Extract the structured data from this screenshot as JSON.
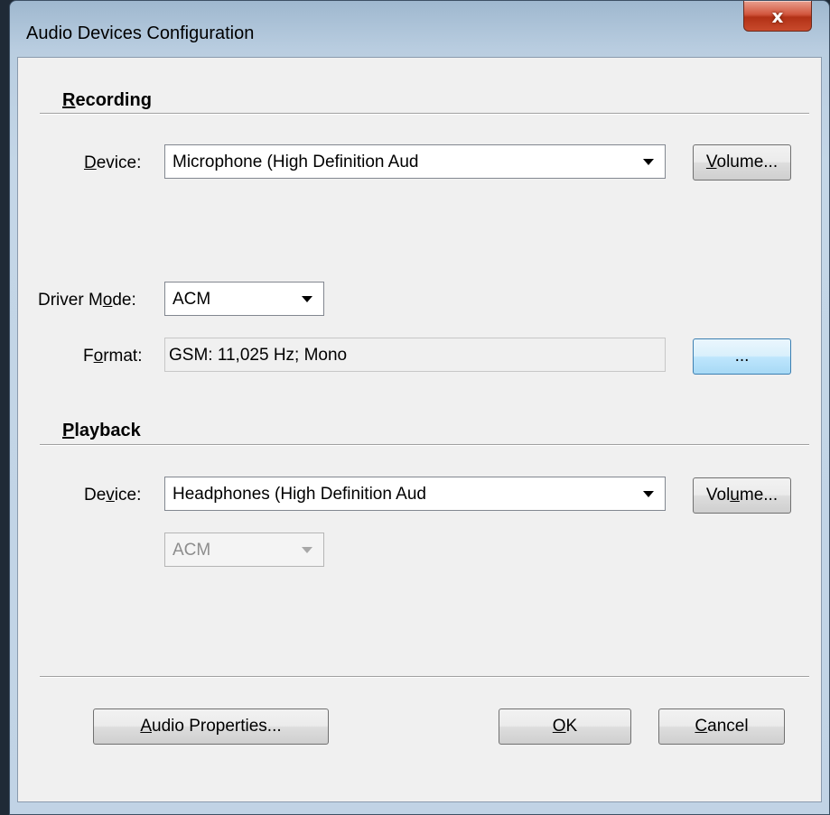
{
  "window": {
    "title": "Audio Devices Configuration",
    "close_glyph": "x"
  },
  "recording": {
    "group_label_first": "R",
    "group_label_rest": "ecording",
    "device_label_pre": "",
    "device_label_key": "D",
    "device_label_post": "evice:",
    "device_value": "Microphone (High Definition Aud",
    "volume_key": "V",
    "volume_rest": "olume...",
    "driver_mode_label_pre": "Driver M",
    "driver_mode_label_key": "o",
    "driver_mode_label_post": "de:",
    "driver_mode_value": "ACM",
    "format_label_pre": "F",
    "format_label_key": "o",
    "format_label_post": "rmat:",
    "format_value": "GSM: 11,025 Hz; Mono",
    "format_button": "..."
  },
  "playback": {
    "group_label_first": "P",
    "group_label_rest": "layback",
    "device_label_pre": "De",
    "device_label_key": "v",
    "device_label_post": "ice:",
    "device_value": "Headphones (High Definition Aud",
    "volume_pre": "Vol",
    "volume_key": "u",
    "volume_post": "me...",
    "driver_mode_value": "ACM"
  },
  "footer": {
    "audio_properties_key": "A",
    "audio_properties_rest": "udio Properties...",
    "ok_key": "O",
    "ok_rest": "K",
    "cancel_key": "C",
    "cancel_rest": "ancel"
  },
  "colors": {
    "titlebar": "#b9cde0",
    "close": "#c84a2c",
    "dialog": "#f0f0f0",
    "focus_button": "#bee6fd"
  }
}
